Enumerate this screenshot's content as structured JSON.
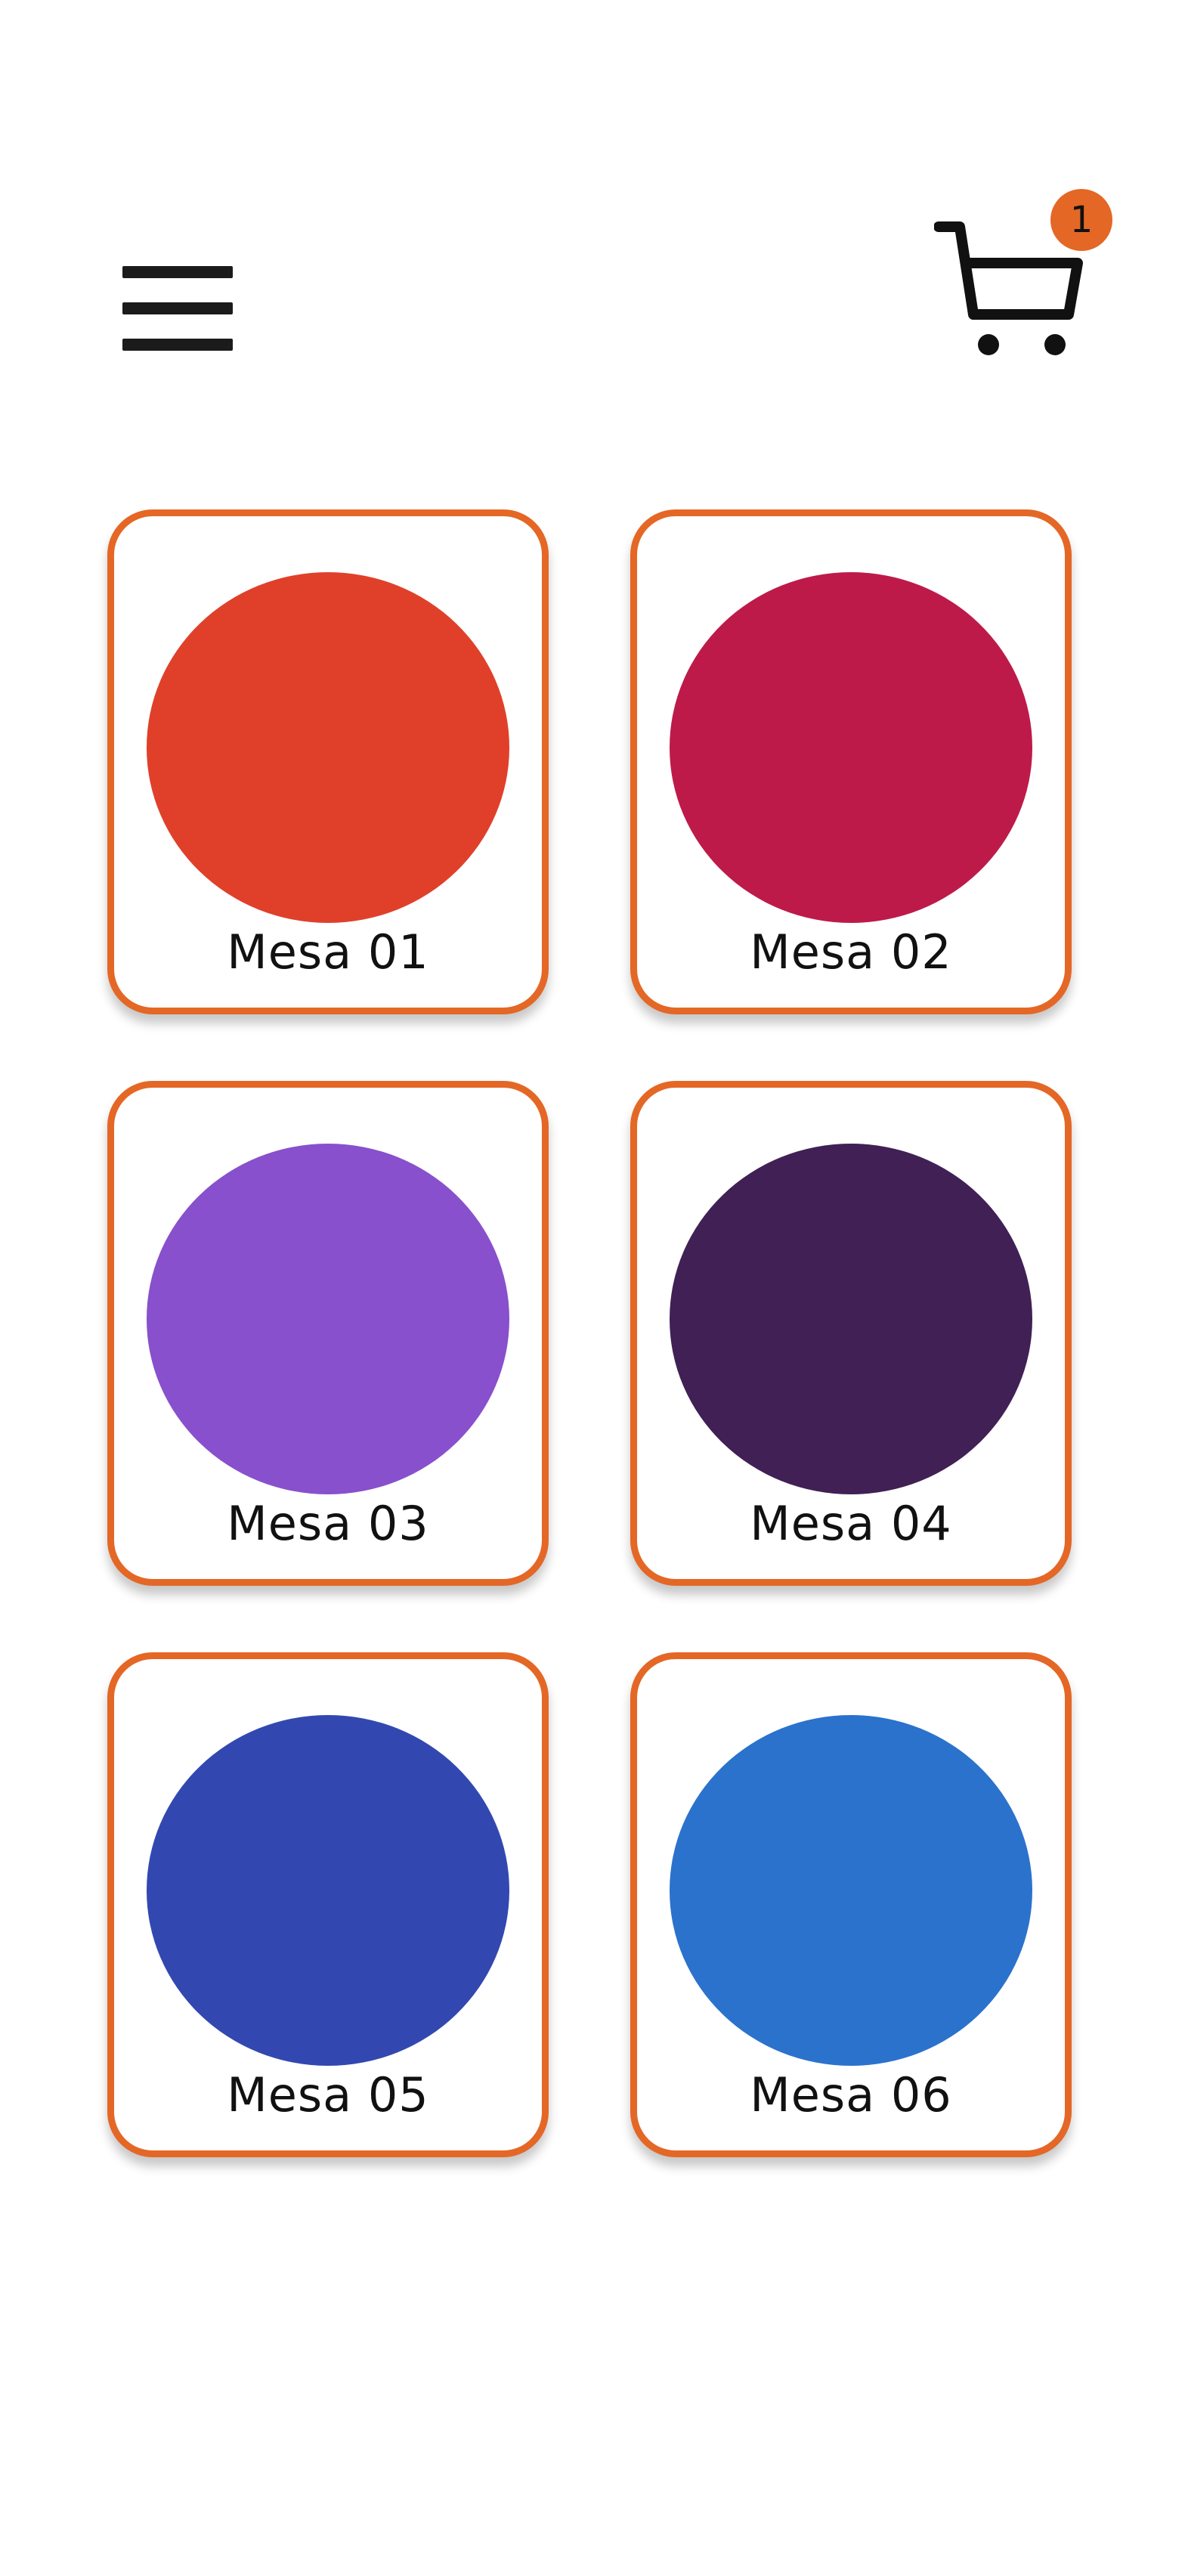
{
  "header": {
    "menu_icon": "hamburger-menu-icon",
    "cart_icon": "shopping-cart-icon",
    "cart_count": "1",
    "badge_color": "#e46726"
  },
  "tables": [
    {
      "label": "Mesa 01",
      "color": "#e0402a"
    },
    {
      "label": "Mesa 02",
      "color": "#bd1a4a"
    },
    {
      "label": "Mesa 03",
      "color": "#8850cc"
    },
    {
      "label": "Mesa 04",
      "color": "#402055"
    },
    {
      "label": "Mesa 05",
      "color": "#3248b0"
    },
    {
      "label": "Mesa 06",
      "color": "#2b72cc"
    }
  ],
  "theme": {
    "accent": "#e46726"
  }
}
